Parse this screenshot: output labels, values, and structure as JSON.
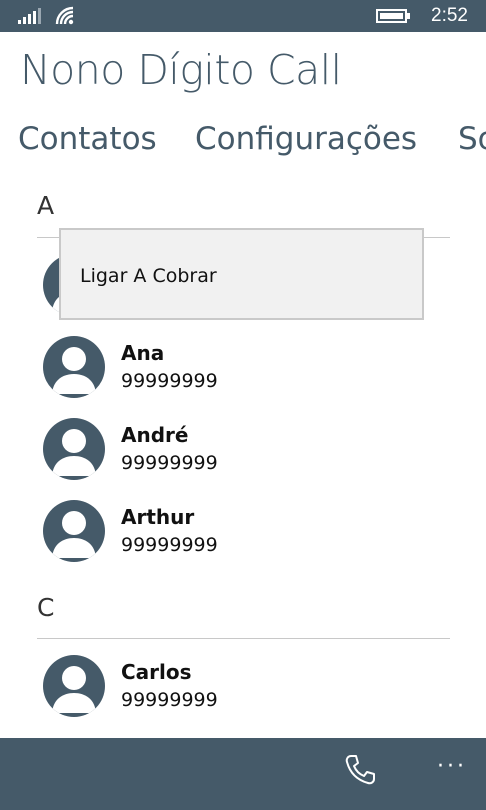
{
  "status_bar": {
    "time": "2:52",
    "icons": [
      "signal-icon",
      "wifi-icon",
      "battery-icon"
    ]
  },
  "app": {
    "title": "Nono Dígito Call"
  },
  "pivot": {
    "items": [
      {
        "label": "Contatos"
      },
      {
        "label": "Configurações"
      },
      {
        "label": "So"
      }
    ]
  },
  "groups": [
    {
      "letter": "A",
      "contacts": [
        {
          "name": "Ana",
          "phone": "99999999"
        },
        {
          "name": "André",
          "phone": "99999999"
        },
        {
          "name": "Arthur",
          "phone": "99999999"
        }
      ]
    },
    {
      "letter": "C",
      "contacts": [
        {
          "name": "Carlos",
          "phone": "99999999"
        }
      ]
    }
  ],
  "context_menu": {
    "items": [
      {
        "label": "Ligar A Cobrar"
      }
    ]
  },
  "app_bar": {
    "buttons": [
      "phone-icon",
      "more-icon"
    ],
    "more_label": "···"
  },
  "colors": {
    "accent": "#455a69",
    "background": "#ffffff",
    "menu_background": "#f1f1f1"
  }
}
